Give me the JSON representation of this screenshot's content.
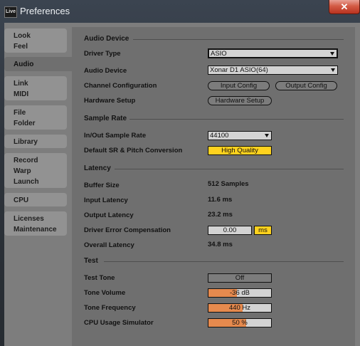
{
  "window": {
    "title": "Preferences",
    "icon_text": "Live",
    "close_glyph": "✕"
  },
  "sidebar": {
    "tabs": [
      {
        "lines": [
          "Look",
          "Feel"
        ]
      },
      {
        "lines": [
          "Audio"
        ]
      },
      {
        "lines": [
          "Link",
          "MIDI"
        ]
      },
      {
        "lines": [
          "File",
          "Folder"
        ]
      },
      {
        "lines": [
          "Library"
        ]
      },
      {
        "lines": [
          "Record",
          "Warp",
          "Launch"
        ]
      },
      {
        "lines": [
          "CPU"
        ]
      },
      {
        "lines": [
          "Licenses",
          "Maintenance"
        ]
      }
    ],
    "active": "Audio"
  },
  "sections": {
    "audio_device": "Audio Device",
    "sample_rate": "Sample Rate",
    "latency": "Latency",
    "test": "Test"
  },
  "labels": {
    "driver_type": "Driver Type",
    "audio_device": "Audio Device",
    "channel_configuration": "Channel Configuration",
    "hardware_setup": "Hardware Setup",
    "in_out_sample_rate": "In/Out Sample Rate",
    "default_sr": "Default SR & Pitch Conversion",
    "buffer_size": "Buffer Size",
    "input_latency": "Input Latency",
    "output_latency": "Output Latency",
    "driver_error_compensation": "Driver Error Compensation",
    "overall_latency": "Overall Latency",
    "test_tone": "Test Tone",
    "tone_volume": "Tone Volume",
    "tone_frequency": "Tone Frequency",
    "cpu_usage_simulator": "CPU Usage Simulator"
  },
  "values": {
    "driver_type": "ASIO",
    "audio_device": "Xonar D1 ASIO(64)",
    "input_config": "Input Config",
    "output_config": "Output Config",
    "hardware_setup": "Hardware Setup",
    "sample_rate": "44100",
    "sr_conversion": "High Quality",
    "buffer_size": "512 Samples",
    "input_latency": "11.6 ms",
    "output_latency": "23.2 ms",
    "driver_error_compensation": "0.00",
    "driver_error_unit": "ms",
    "overall_latency": "34.8 ms",
    "test_tone": "Off",
    "tone_volume": "-36 dB",
    "tone_volume_fill": 0.45,
    "tone_frequency": "440 Hz",
    "tone_frequency_fill": 0.55,
    "cpu_usage": "50 %",
    "cpu_usage_fill": 0.6
  },
  "colors": {
    "accent_orange": "#e68a4e",
    "accent_yellow": "#ffd21e",
    "close_red": "#d35b45"
  }
}
